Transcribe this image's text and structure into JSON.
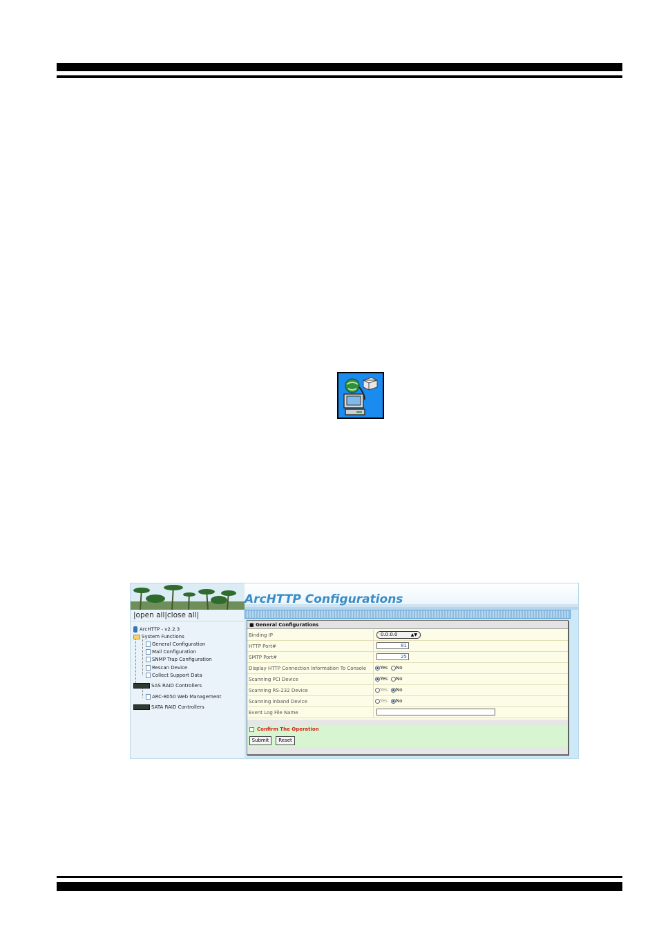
{
  "app_icon": "network-computer-icon",
  "screenshot": {
    "banner_title": "ArcHTTP Configurations",
    "tree_controls": {
      "open_all": "open all",
      "close_all": "close all",
      "sep_left": "|",
      "sep_mid": "|",
      "sep_right": "|"
    },
    "tree": {
      "root": "ArcHTTP - v2.2.3",
      "system_functions": "System Functions",
      "items": [
        "General Configuration",
        "Mail Configuration",
        "SNMP Trap Configuration",
        "Rescan Device",
        "Collect Support Data"
      ],
      "sas_controllers": "SAS RAID Controllers",
      "sas_child": "ARC-8050 Web Management",
      "sata_controllers": "SATA RAID Controllers"
    },
    "panel": {
      "header": "General Configurations",
      "binding_ip_label": "Binding IP",
      "binding_ip_value": "0.0.0.0",
      "http_port_label": "HTTP Port#",
      "http_port_value": "81",
      "smtp_port_label": "SMTP Port#",
      "smtp_port_value": "25",
      "display_http_label": "Display HTTP Connection Information To Console",
      "scan_pci_label": "Scanning PCI Device",
      "scan_rs232_label": "Scanning RS-232 Device",
      "scan_inband_label": "Scanning Inband Device",
      "event_log_label": "Event Log File Name",
      "event_log_value": "",
      "yes": "Yes",
      "no": "No",
      "confirm": "Confirm The Operation",
      "submit": "Submit",
      "reset": "Reset"
    }
  }
}
